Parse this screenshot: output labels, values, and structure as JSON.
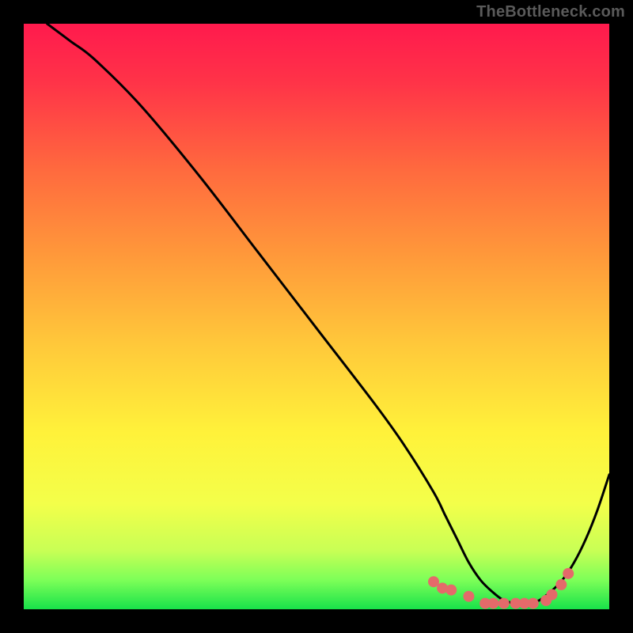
{
  "watermark": "TheBottleneck.com",
  "chart_data": {
    "type": "line",
    "title": "",
    "xlabel": "",
    "ylabel": "",
    "xlim": [
      0,
      100
    ],
    "ylim": [
      0,
      100
    ],
    "grid": false,
    "legend": false,
    "series": [
      {
        "name": "bottleneck-curve",
        "x": [
          4,
          8,
          12,
          20,
          30,
          40,
          50,
          60,
          65,
          70,
          72,
          74,
          76,
          78,
          80,
          82,
          84,
          86,
          88,
          90,
          92,
          94,
          96,
          98,
          100
        ],
        "y": [
          100,
          97,
          94,
          86,
          74,
          61,
          48,
          35,
          28,
          20,
          16,
          12,
          8,
          5,
          3,
          1.5,
          1,
          1,
          1.5,
          3,
          5,
          8,
          12,
          17,
          23
        ]
      }
    ],
    "markers": {
      "name": "highlight-dots",
      "color": "#e46a6a",
      "x": [
        70,
        71.5,
        73,
        76,
        78.8,
        80.2,
        82,
        84,
        85.5,
        87,
        89.2,
        90.2,
        91.8,
        93
      ],
      "y": [
        4.7,
        3.6,
        3.3,
        2.2,
        1.0,
        1.0,
        1.0,
        1.0,
        1.0,
        1.0,
        1.5,
        2.5,
        4.2,
        6.1
      ]
    },
    "gradient_stops": [
      {
        "offset": 0.0,
        "color": "#ff1a4d"
      },
      {
        "offset": 0.1,
        "color": "#ff3348"
      },
      {
        "offset": 0.25,
        "color": "#ff6a3e"
      },
      {
        "offset": 0.4,
        "color": "#ff9a3a"
      },
      {
        "offset": 0.55,
        "color": "#ffc93a"
      },
      {
        "offset": 0.7,
        "color": "#fff23a"
      },
      {
        "offset": 0.82,
        "color": "#f3ff4a"
      },
      {
        "offset": 0.9,
        "color": "#c8ff55"
      },
      {
        "offset": 0.95,
        "color": "#7dff58"
      },
      {
        "offset": 1.0,
        "color": "#18e24a"
      }
    ]
  }
}
